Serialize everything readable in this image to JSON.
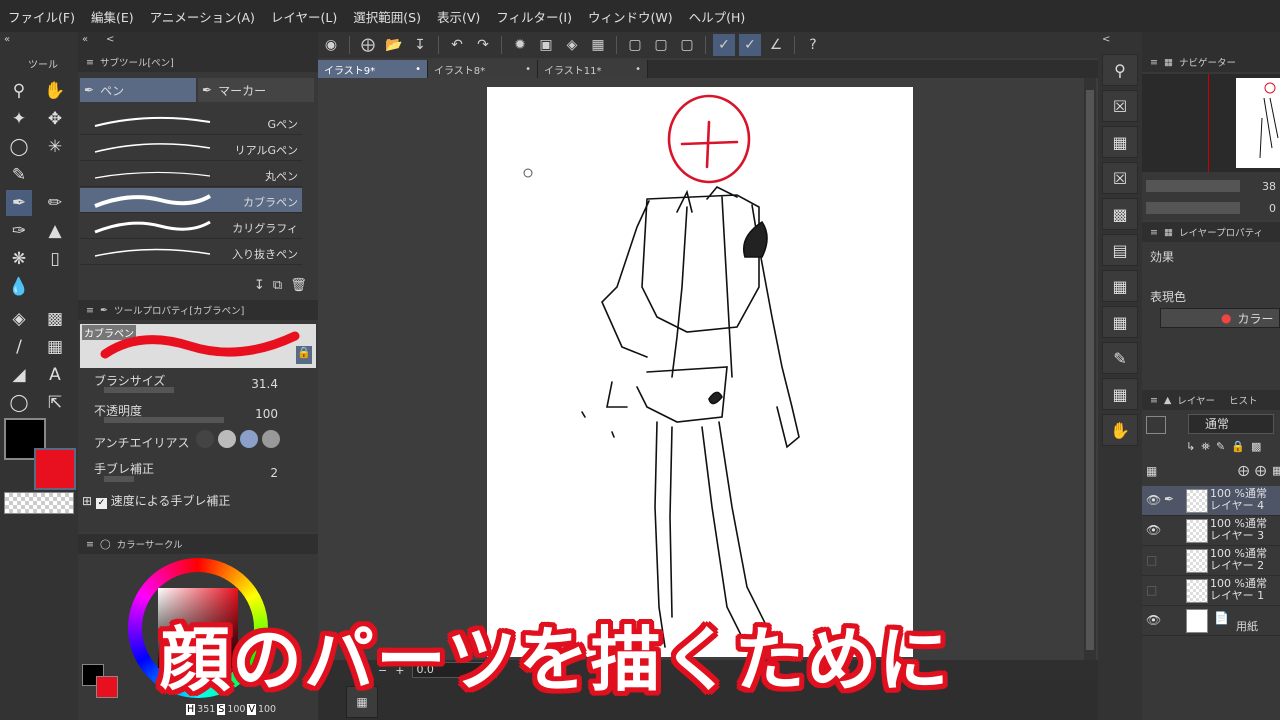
{
  "menu": [
    "ファイル(F)",
    "編集(E)",
    "アニメーション(A)",
    "レイヤー(L)",
    "選択範囲(S)",
    "表示(V)",
    "フィルター(I)",
    "ウィンドウ(W)",
    "ヘルプ(H)"
  ],
  "tabs": [
    {
      "label": "イラスト9*"
    },
    {
      "label": "イラスト8*"
    },
    {
      "label": "イラスト11*"
    }
  ],
  "subtool": {
    "header": "サブツール[ペン]",
    "group_tabs": [
      "ペン",
      "マーカー"
    ],
    "brushes": [
      "Gペン",
      "リアルGペン",
      "丸ペン",
      "カブラペン",
      "カリグラフィ",
      "入り抜きペン"
    ]
  },
  "toolprop": {
    "header": "ツールプロパティ[カブラペン]",
    "preset_name": "カブラペン",
    "brush_size_label": "ブラシサイズ",
    "brush_size_value": "31.4",
    "opacity_label": "不透明度",
    "opacity_value": "100",
    "antialias_label": "アンチエイリアス",
    "stabilization_label": "手ブレ補正",
    "stabilization_value": "2",
    "speed_stabilization_label": "速度による手ブレ補正"
  },
  "toolcol": {
    "header": "ツール"
  },
  "colorpanel": {
    "header": "カラーサークル",
    "h_label": "H",
    "h": "351",
    "s_label": "S",
    "s": "100",
    "v_label": "V",
    "v": "100"
  },
  "colors": {
    "main": "#e8101f",
    "accent": "#4a5d7c",
    "caption_outline": "#e0101e"
  },
  "navigator": {
    "header": "ナビゲーター",
    "zoom": "38",
    "rotation": "0"
  },
  "layerprop": {
    "header": "レイヤープロパティ",
    "effect_label": "効果",
    "expression_label": "表現色",
    "color_button": "カラー"
  },
  "layerpanel": {
    "header": "レイヤー",
    "header2": "ヒスト",
    "blend_mode": "通常",
    "layers": [
      {
        "pct": "100 %通常",
        "name": "レイヤー 4"
      },
      {
        "pct": "100 %通常",
        "name": "レイヤー 3"
      },
      {
        "pct": "100 %通常",
        "name": "レイヤー 2"
      },
      {
        "pct": "100 %通常",
        "name": "レイヤー 1"
      },
      {
        "pct": "",
        "name": "用紙"
      }
    ]
  },
  "timeline": {
    "frame_value": "0.0"
  },
  "caption": "顔のパーツを描くために"
}
